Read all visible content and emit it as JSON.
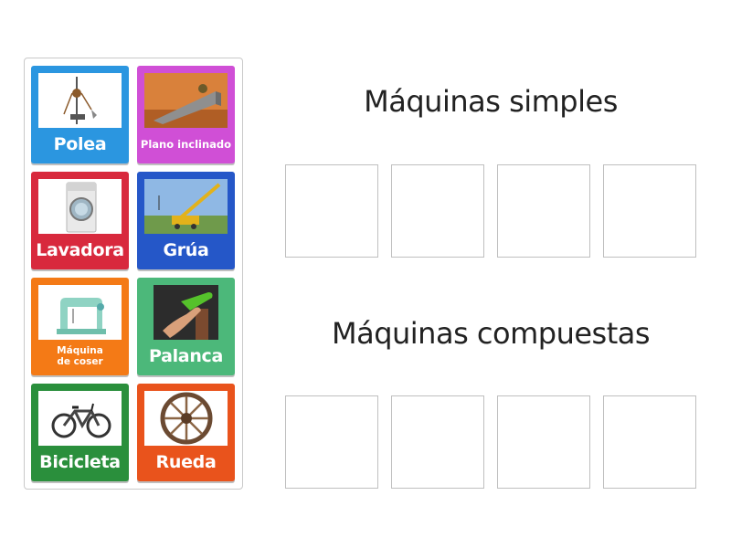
{
  "categories": [
    {
      "title": "Máquinas simples"
    },
    {
      "title": "Máquinas compuestas"
    }
  ],
  "cards": [
    {
      "label": "Polea",
      "color": "#2b96e0",
      "icon": "pulley-icon"
    },
    {
      "label": "Plano inclinado",
      "color": "#d04fd6",
      "icon": "inclined-plane-icon"
    },
    {
      "label": "Lavadora",
      "color": "#d8293d",
      "icon": "washing-machine-icon"
    },
    {
      "label": "Grúa",
      "color": "#2557c8",
      "icon": "crane-icon"
    },
    {
      "label": "Máquina\nde coser",
      "color": "#f47a16",
      "icon": "sewing-machine-icon"
    },
    {
      "label": "Palanca",
      "color": "#4cb87a",
      "icon": "lever-icon"
    },
    {
      "label": "Bicicleta",
      "color": "#2a8f3c",
      "icon": "bicycle-icon"
    },
    {
      "label": "Rueda",
      "color": "#e9531c",
      "icon": "wheel-icon"
    }
  ]
}
